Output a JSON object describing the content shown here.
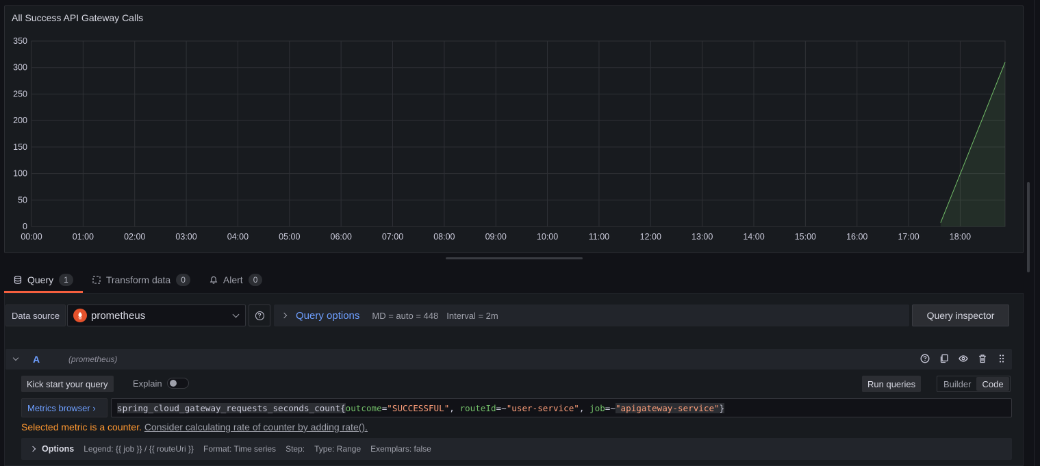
{
  "panel": {
    "title": "All Success API Gateway Calls"
  },
  "chart_data": {
    "type": "area",
    "title": "All Success API Gateway Calls",
    "xlabel": "",
    "ylabel": "",
    "x_ticks": [
      "00:00",
      "01:00",
      "02:00",
      "03:00",
      "04:00",
      "05:00",
      "06:00",
      "07:00",
      "08:00",
      "09:00",
      "10:00",
      "11:00",
      "12:00",
      "13:00",
      "14:00",
      "15:00",
      "16:00",
      "17:00",
      "18:00"
    ],
    "y_ticks": [
      0,
      50,
      100,
      150,
      200,
      250,
      300,
      350
    ],
    "ylim": [
      0,
      350
    ],
    "xlim_hours": [
      0,
      18.87
    ],
    "grid": true,
    "series": [
      {
        "color": "#73bf69",
        "x_hours": [
          17.62,
          18.87
        ],
        "values": [
          7,
          310
        ]
      }
    ]
  },
  "tabs": [
    {
      "label": "Query",
      "count": "1",
      "icon": "database-icon"
    },
    {
      "label": "Transform data",
      "count": "0",
      "icon": "transform-icon"
    },
    {
      "label": "Alert",
      "count": "0",
      "icon": "bell-icon"
    }
  ],
  "datasource": {
    "label": "Data source",
    "value": "prometheus"
  },
  "query_options": {
    "title": "Query options",
    "md": "MD = auto = 448",
    "interval": "Interval = 2m"
  },
  "query_inspector": "Query inspector",
  "query": {
    "ref": "A",
    "ds": "(prometheus)",
    "kick_start": "Kick start your query",
    "explain": "Explain",
    "run": "Run queries",
    "mode_builder": "Builder",
    "mode_code": "Code",
    "metrics_browser": "Metrics browser ›",
    "code": {
      "metric": "spring_cloud_gateway_requests_seconds_count",
      "l1": "outcome",
      "v1": "\"SUCCESSFUL\"",
      "l2": "routeId",
      "v2": "\"user-service\"",
      "l3": "job",
      "v3": "\"apigateway-service\""
    },
    "warning": "Selected metric is a counter.",
    "warning_link": "Consider calculating rate of counter by adding rate().",
    "options_label": "Options",
    "opt_legend": "Legend: {{ job }} / {{ routeUri }}",
    "opt_format": "Format: Time series",
    "opt_step": "Step:",
    "opt_type": "Type: Range",
    "opt_exemplars": "Exemplars: false"
  },
  "colors": {
    "accent": "#f55f3e",
    "link": "#6e9fff",
    "series": "#73bf69",
    "warning": "#ff9830"
  }
}
